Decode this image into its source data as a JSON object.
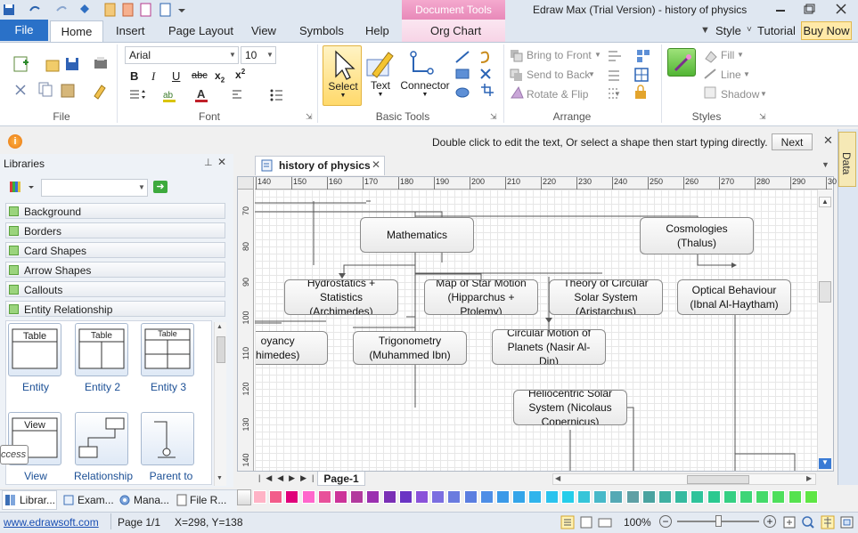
{
  "window": {
    "title": "Edraw Max (Trial Version) - history of physics",
    "contextual_tab": "Document Tools"
  },
  "ribbon": {
    "tabs": [
      "File",
      "Home",
      "Insert",
      "Page Layout",
      "View",
      "Symbols",
      "Help",
      "Org Chart"
    ],
    "right_links": {
      "style": "Style",
      "tutorial": "Tutorial",
      "buy_now": "Buy Now"
    },
    "groups": {
      "file": "File",
      "font": "Font",
      "basic_tools": "Basic Tools",
      "arrange": "Arrange",
      "styles": "Styles"
    },
    "font": {
      "family": "Arial",
      "size": "10"
    },
    "basic_tools": {
      "select": "Select",
      "text": "Text",
      "connector": "Connector"
    },
    "arrange": {
      "bring_front": "Bring to Front",
      "send_back": "Send to Back",
      "rotate_flip": "Rotate & Flip"
    },
    "styles": {
      "fill": "Fill",
      "line": "Line",
      "shadow": "Shadow"
    }
  },
  "infobar": {
    "message": "Double click to edit the text, Or select a shape then start typing directly.",
    "next": "Next"
  },
  "right_panel": {
    "data_tab": "Data"
  },
  "libraries": {
    "title": "Libraries",
    "categories": [
      "Background",
      "Borders",
      "Card Shapes",
      "Arrow Shapes",
      "Callouts",
      "Entity Relationship"
    ],
    "shapes": [
      {
        "label": "Entity",
        "thumb": "Table"
      },
      {
        "label": "Entity 2",
        "thumb": "Table"
      },
      {
        "label": "Entity 3",
        "thumb": "Table"
      },
      {
        "label": "View",
        "thumb": "View"
      },
      {
        "label": "Relationship",
        "thumb": ""
      },
      {
        "label": "Parent to",
        "thumb": ""
      }
    ],
    "tooltip_fragment": "ccess"
  },
  "document": {
    "tab_title": "history of physics",
    "page_tab": "Page-1",
    "ruler_h": [
      "140",
      "150",
      "160",
      "170",
      "180",
      "190",
      "200",
      "210",
      "220",
      "230",
      "240",
      "250",
      "260",
      "270",
      "280",
      "290",
      "30"
    ],
    "ruler_v": [
      "70",
      "80",
      "90",
      "100",
      "110",
      "120",
      "130",
      "140"
    ]
  },
  "diagram": {
    "nodes": [
      {
        "id": "mathematics",
        "text": "Mathematics"
      },
      {
        "id": "cosmologies",
        "text": "Cosmologies\n(Thalus)"
      },
      {
        "id": "hydrostatics",
        "text": "Hydrostatics +\nStatistics\n(Archimedes)"
      },
      {
        "id": "star_map",
        "text": "Map of Star Motion\n(Hipparchus +\nPtolemy)"
      },
      {
        "id": "circular_theory",
        "text": "Theory of Circular\nSolar System\n(Aristarchus)"
      },
      {
        "id": "optical",
        "text": "Optical Behaviour\n(Ibnal Al-Haytham)"
      },
      {
        "id": "buoyancy",
        "text": "oyancy\nhimedes)"
      },
      {
        "id": "trigonometry",
        "text": "Trigonometry\n(Muhammed Ibn)"
      },
      {
        "id": "circular_motion",
        "text": "Circular Motion of\nPlanets (Nasir Al-\nDin)"
      },
      {
        "id": "heliocentric",
        "text": "Heliocentric Solar\nSystem (Nicolaus\nCopernicus)"
      }
    ]
  },
  "bottom_tabs": [
    "Librar...",
    "Exam...",
    "Mana...",
    "File R..."
  ],
  "status": {
    "link": "www.edrawsoft.com",
    "page": "Page 1/1",
    "coords": "X=298, Y=138",
    "zoom": "100%"
  },
  "colors": {
    "accent": "#2a71c8",
    "context_tab": "#e889b9",
    "palette": [
      "#ffb3c6",
      "#f25c8a",
      "#e0007a",
      "#ff66cc",
      "#e8509a",
      "#cc3399",
      "#b23a9e",
      "#9b30b0",
      "#7a2fb5",
      "#6a35c4",
      "#8a52d9",
      "#7b6ee0",
      "#6a7bdf",
      "#5b7ee0",
      "#4e8ee6",
      "#3b9ae8",
      "#34a5e9",
      "#30b4ec",
      "#2bc3ee",
      "#25cdea",
      "#36c5d9",
      "#48b9c9",
      "#55a9b5",
      "#5fa0a5",
      "#4aa3a0",
      "#40b0a2",
      "#35baa0",
      "#2fc39b",
      "#2cc990",
      "#35cf83",
      "#3ed577",
      "#45da6a",
      "#4edf5c",
      "#56e24f",
      "#5ee644"
    ]
  }
}
